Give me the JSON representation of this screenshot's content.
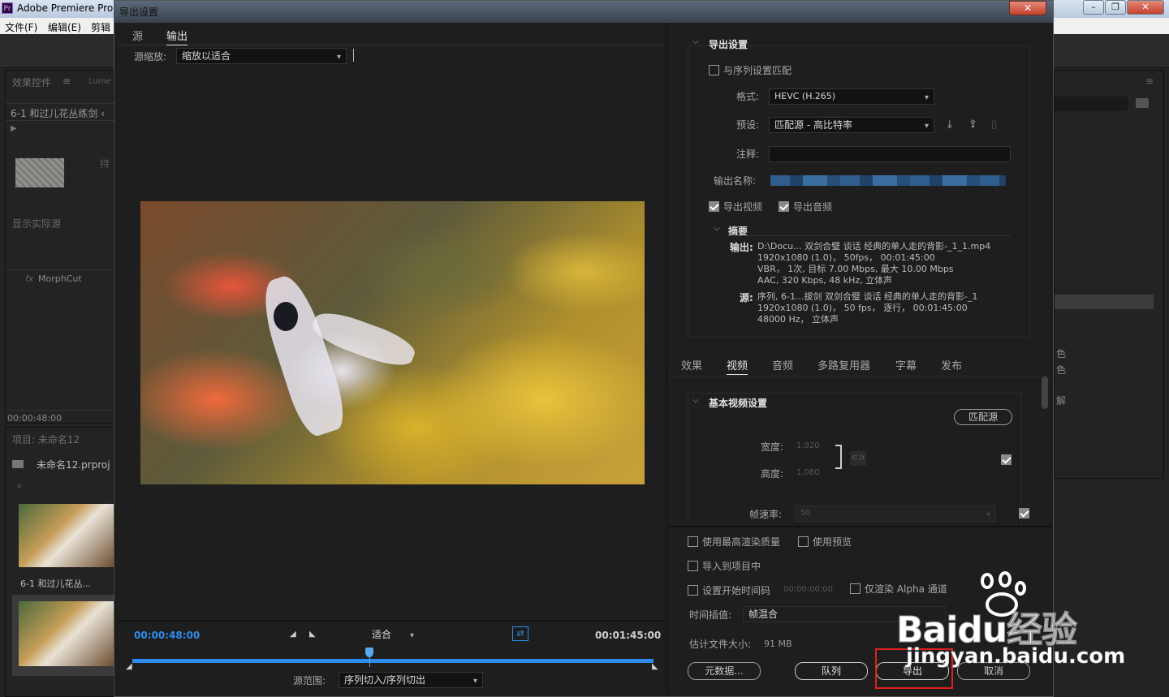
{
  "host": {
    "app_title": "Adobe Premiere Pro",
    "menu": [
      "文件(F)",
      "编辑(E)",
      "剪辑"
    ],
    "effects_tab": "效果控件",
    "lumetri_tab": "Lume",
    "clip_name": "6-1 和过儿花丛练剑 ‹",
    "dim_text_1": "持",
    "show_actual": "显示实际源",
    "morphcut": "MorphCut",
    "timecode": "00:00:48:00",
    "project_label": "项目: 未命名12",
    "project_file": "未命名12.prproj",
    "thumb_label": "6-1 和过儿花丛...",
    "right_side_chars": [
      "色",
      "色",
      "解"
    ]
  },
  "dialog": {
    "title": "导出设置",
    "close_label": "✕",
    "tabs": [
      "源",
      "输出"
    ],
    "source_scale_label": "源缩放:",
    "source_scale_value": "缩放以适合",
    "timeline": {
      "current_time": "00:00:48:00",
      "fit_value": "适合",
      "end_time": "00:01:45:00",
      "range_label": "源范围:",
      "range_value": "序列切入/序列切出"
    },
    "export_settings": {
      "header": "导出设置",
      "match_sequence": "与序列设置匹配",
      "format_label": "格式:",
      "format_value": "HEVC (H.265)",
      "preset_label": "预设:",
      "preset_value": "匹配源 - 高比特率",
      "comment_label": "注释:",
      "output_name_label": "输出名称:",
      "export_video": "导出视频",
      "export_audio": "导出音频",
      "summary_header": "摘要",
      "output_label": "输出:",
      "output_lines": [
        "D:\\Docu... 双剑合璧 谈话 经典的单人走的背影-_1_1.mp4",
        "1920x1080 (1.0)， 50fps， 00:01:45:00",
        "VBR， 1次, 目标 7.00 Mbps, 最大 10.00 Mbps",
        "AAC, 320 Kbps, 48 kHz, 立体声"
      ],
      "source_label": "源:",
      "source_lines": [
        "序列, 6-1...拔剑 双剑合璧 谈话 经典的单人走的背影-_1",
        "1920x1080 (1.0)， 50 fps， 逐行， 00:01:45:00",
        "48000 Hz， 立体声"
      ]
    },
    "settings_tabs": [
      "效果",
      "视频",
      "音频",
      "多路复用器",
      "字幕",
      "发布"
    ],
    "active_settings_tab": "视频",
    "video_basic": {
      "header": "基本视频设置",
      "match_source_button": "匹配源",
      "width_label": "宽度:",
      "width_value": "1,920",
      "height_label": "高度:",
      "height_value": "1,080",
      "fps_label": "帧速率:",
      "fps_value": "50"
    },
    "bottom": {
      "max_render": "使用最高渲染质量",
      "use_preview": "使用预览",
      "import_project": "导入到项目中",
      "set_timecode": "设置开始时间码",
      "timecode_value": "00:00:00:00",
      "render_alpha": "仅渲染 Alpha 通道",
      "interp_label": "时间插值:",
      "interp_value": "帧混合",
      "filesize_label": "估计文件大小:",
      "filesize_value": "91 MB",
      "metadata_button": "元数据...",
      "queue_button": "队列",
      "export_button": "导出",
      "cancel_button": "取消"
    }
  },
  "watermark": {
    "brand": "Baidu经验",
    "url": "jingyan.baidu.com"
  },
  "colors": {
    "accent": "#2d8ceb",
    "highlight_box": "#e0201b",
    "window_bg": "#1d1d1d"
  }
}
